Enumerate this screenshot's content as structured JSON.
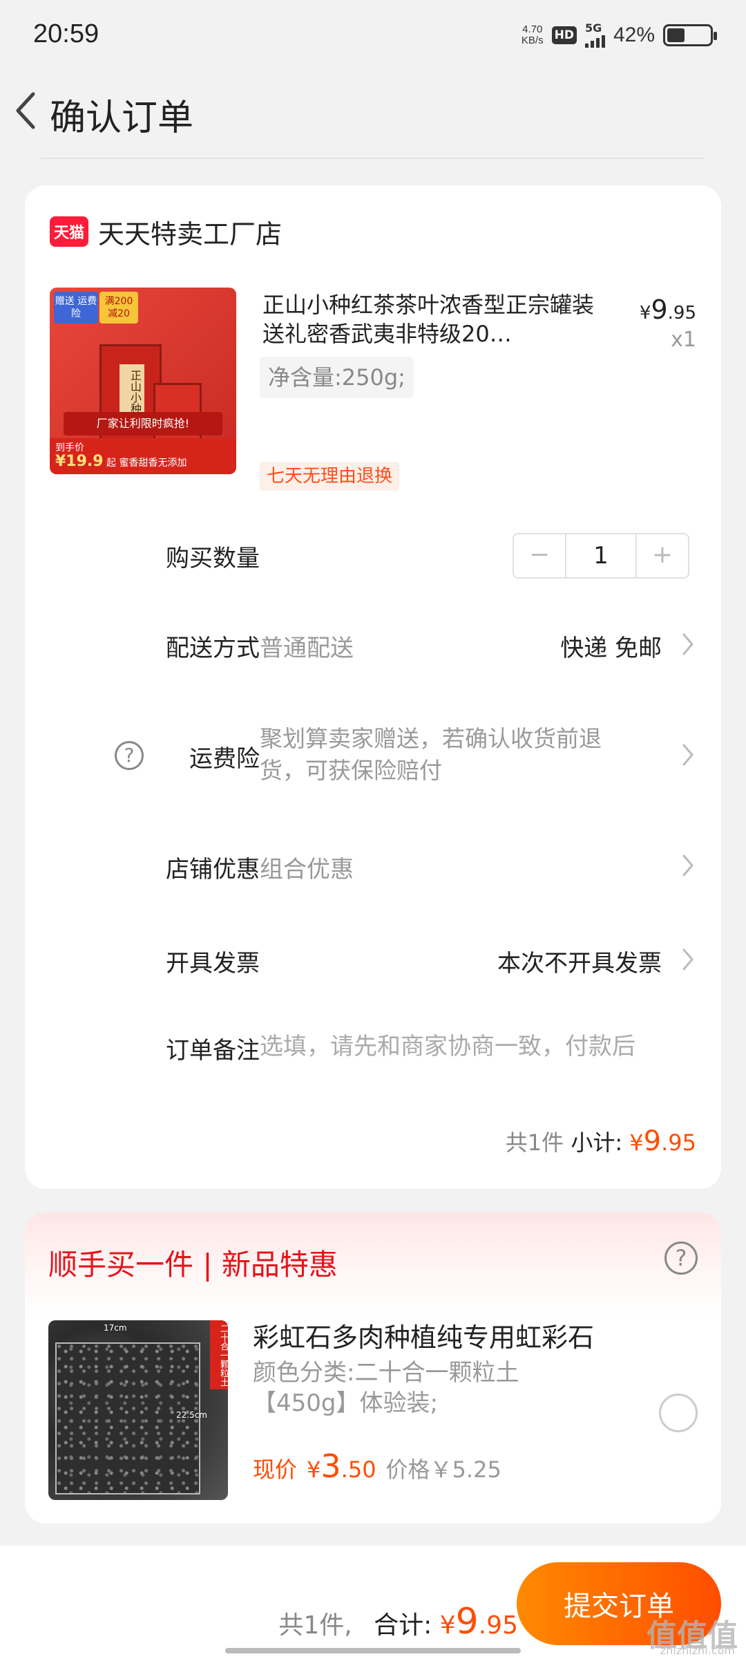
{
  "status_bar": {
    "time": "20:59",
    "net_speed_value": "4.70",
    "net_speed_unit": "KB/s",
    "hd": "HD",
    "network": "5G",
    "battery_percent": "42%",
    "battery_level": 0.42
  },
  "header": {
    "title": "确认订单",
    "back_icon": "chevron-left-icon"
  },
  "shop": {
    "badge": "天猫",
    "name": "天天特卖工厂店"
  },
  "product": {
    "image_tags": [
      "赠送 运费险",
      "满200 减20"
    ],
    "image_can_label": "正山小种",
    "image_banner": "厂家让利限时疯抢!",
    "image_price_label": "到手价",
    "image_price": "¥19.9",
    "image_price_suffix": "起 蜜香甜香无添加",
    "title": "正山小种红茶茶叶浓香型正宗罐装送礼密香武夷非特级20…",
    "currency": "¥",
    "price_int": "9",
    "price_dec": ".95",
    "quantity": "x1",
    "spec": "净含量:250g;",
    "return_policy": "七天无理由退换"
  },
  "rows": {
    "qty_label": "购买数量",
    "qty_value": "1",
    "qty_minus": "−",
    "qty_plus": "+",
    "delivery_label": "配送方式",
    "delivery_value": "普通配送",
    "delivery_right": "快递 免邮",
    "insurance_label": "运费险",
    "insurance_value": "聚划算卖家赠送，若确认收货前退货，可获保险赔付",
    "discount_label": "店铺优惠",
    "discount_value": "组合优惠",
    "invoice_label": "开具发票",
    "invoice_right": "本次不开具发票",
    "remark_label": "订单备注",
    "remark_placeholder": "选填，请先和商家协商一致，付款后"
  },
  "subtotal": {
    "count": "共1件",
    "label": "小计:",
    "currency": "¥",
    "amount_int": "9",
    "amount_dec": ".95"
  },
  "promo": {
    "title": "顺手买一件 | 新品特惠",
    "image_ribbon": "二十合一颗粒土",
    "image_dim_width": "17cm",
    "image_dim_height": "22.5cm",
    "name": "彩虹石多肉种植纯专用虹彩石",
    "spec": "颜色分类:二十合一颗粒土【450g】体验装;",
    "now_label": "现价",
    "currency": "¥",
    "now_int": "3",
    "now_dec": ".50",
    "orig_price": "价格￥5.25"
  },
  "bottom": {
    "count": "共1件,",
    "label": "合计:",
    "currency": "¥",
    "amount_int": "9",
    "amount_dec": ".95",
    "submit": "提交订单",
    "watermark": "值值值",
    "watermark_sub": "zhizhizhi.com"
  },
  "colors": {
    "accent": "#ff4d00",
    "promo_title": "#e5141b",
    "tmall": "#ff1b3a"
  }
}
